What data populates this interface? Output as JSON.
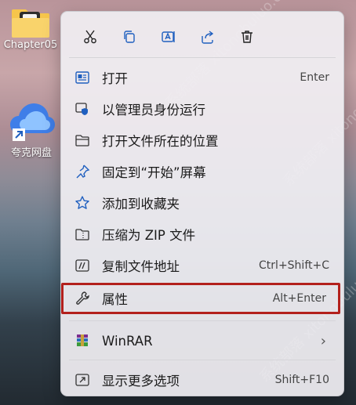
{
  "desktop": {
    "folder_label": "Chapter05",
    "app_label": "夸克网盘"
  },
  "watermark": {
    "text": "系统部落 xitongbuluo.com"
  },
  "menu": {
    "items": [
      {
        "label": "打开",
        "shortcut": "Enter",
        "icon": "open-icon"
      },
      {
        "label": "以管理员身份运行",
        "shortcut": "",
        "icon": "shield-icon"
      },
      {
        "label": "打开文件所在的位置",
        "shortcut": "",
        "icon": "folder-icon"
      },
      {
        "label": "固定到“开始”屏幕",
        "shortcut": "",
        "icon": "pin-icon"
      },
      {
        "label": "添加到收藏夹",
        "shortcut": "",
        "icon": "star-icon"
      },
      {
        "label": "压缩为 ZIP 文件",
        "shortcut": "",
        "icon": "zip-icon"
      },
      {
        "label": "复制文件地址",
        "shortcut": "Ctrl+Shift+C",
        "icon": "copy-path-icon"
      },
      {
        "label": "属性",
        "shortcut": "Alt+Enter",
        "icon": "wrench-icon"
      },
      {
        "label": "WinRAR",
        "shortcut": "",
        "icon": "winrar-icon"
      },
      {
        "label": "显示更多选项",
        "shortcut": "Shift+F10",
        "icon": "more-options-icon"
      }
    ],
    "submenu_arrow": "›"
  },
  "colors": {
    "highlight": "#b3201c",
    "accent_blue": "#1f5fbf"
  }
}
